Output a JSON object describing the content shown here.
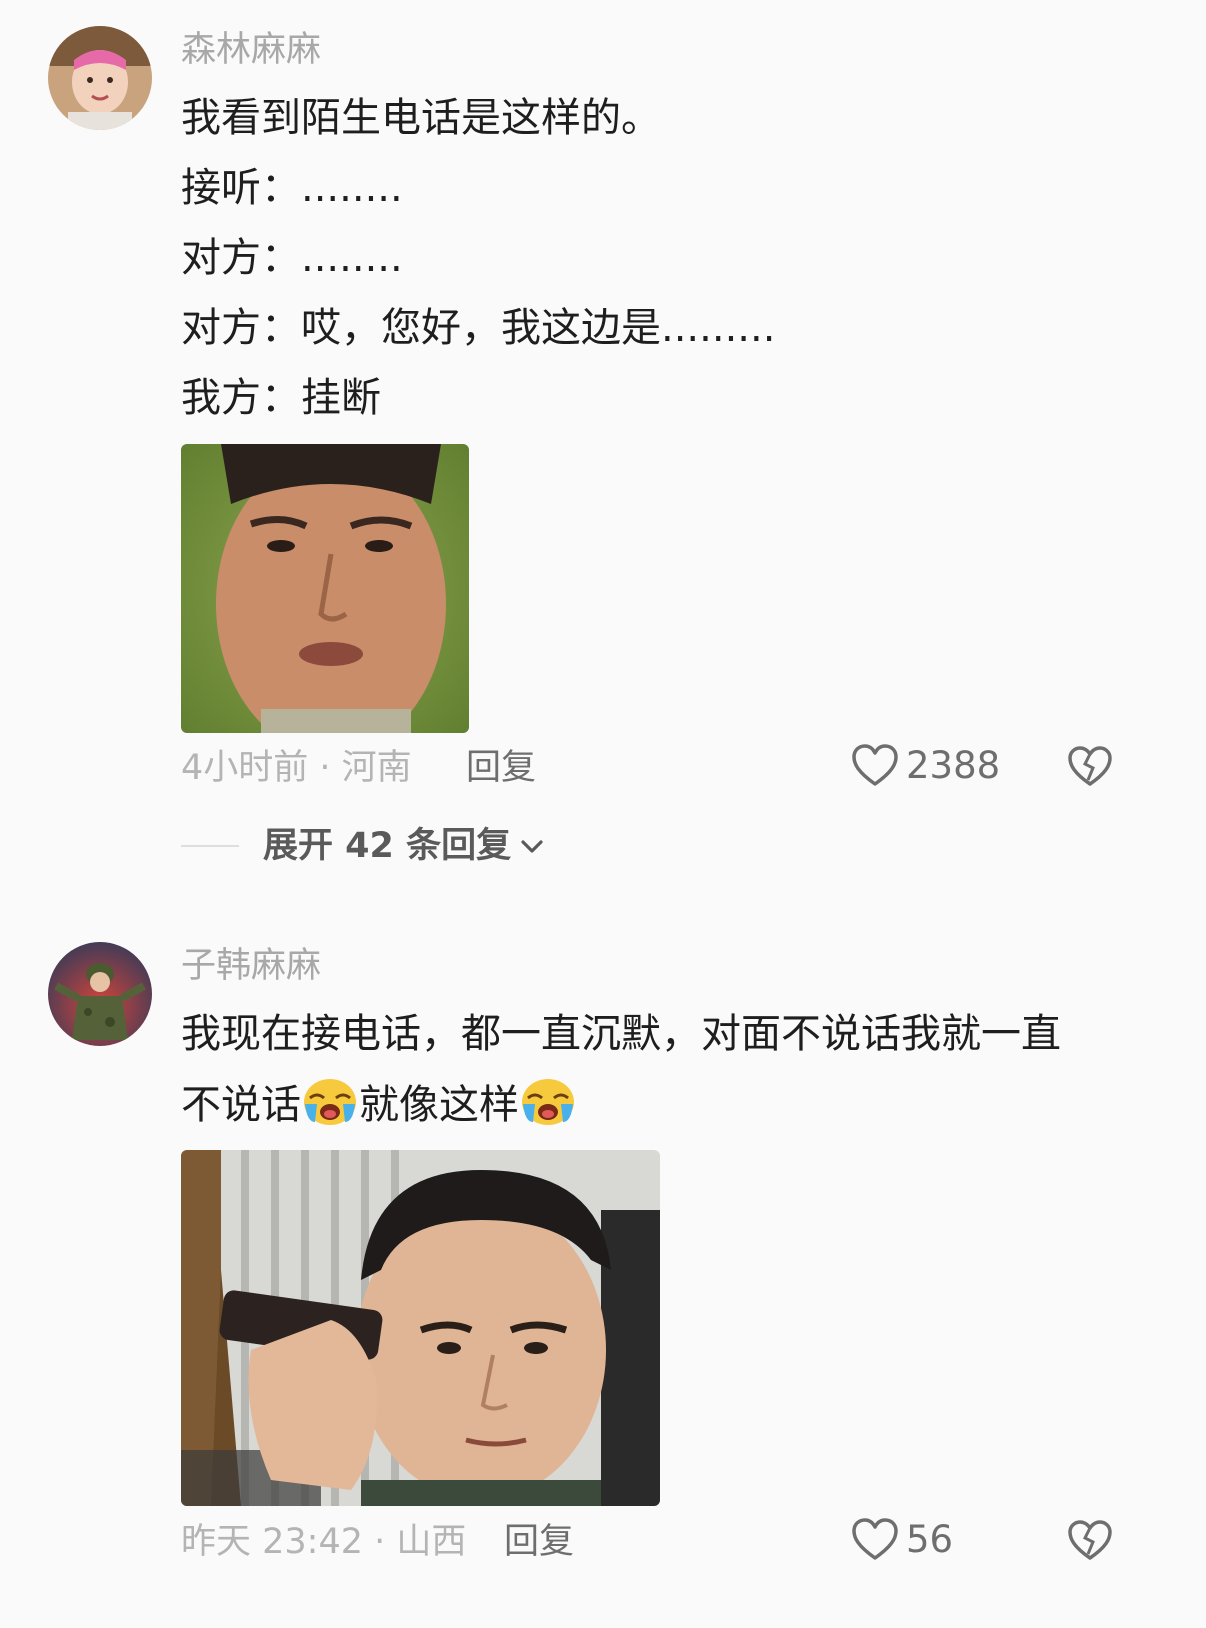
{
  "comments": [
    {
      "username": "森林麻麻",
      "lines": [
        "我看到陌生电话是这样的。",
        "接听：........",
        "对方：........",
        "对方：哎，您好，我这边是.........",
        "我方：挂断"
      ],
      "time_location": "4小时前 · 河南",
      "reply_label": "回复",
      "likes": "2388",
      "expand_label": "展开 42 条回复"
    },
    {
      "username": "子韩麻麻",
      "line1": "我现在接电话，都一直沉默，对面不说话我就一直",
      "line2_part1": "不说话",
      "line2_part2": "就像这样",
      "emoji_icon": "loudly-crying-face-icon",
      "time_location": "昨天 23:42 · 山西",
      "reply_label": "回复",
      "likes": "56"
    }
  ],
  "colors": {
    "background": "#fafafa",
    "username": "#a8a8a8",
    "body_text": "#1e1e1e",
    "meta": "#b4b4b4"
  }
}
